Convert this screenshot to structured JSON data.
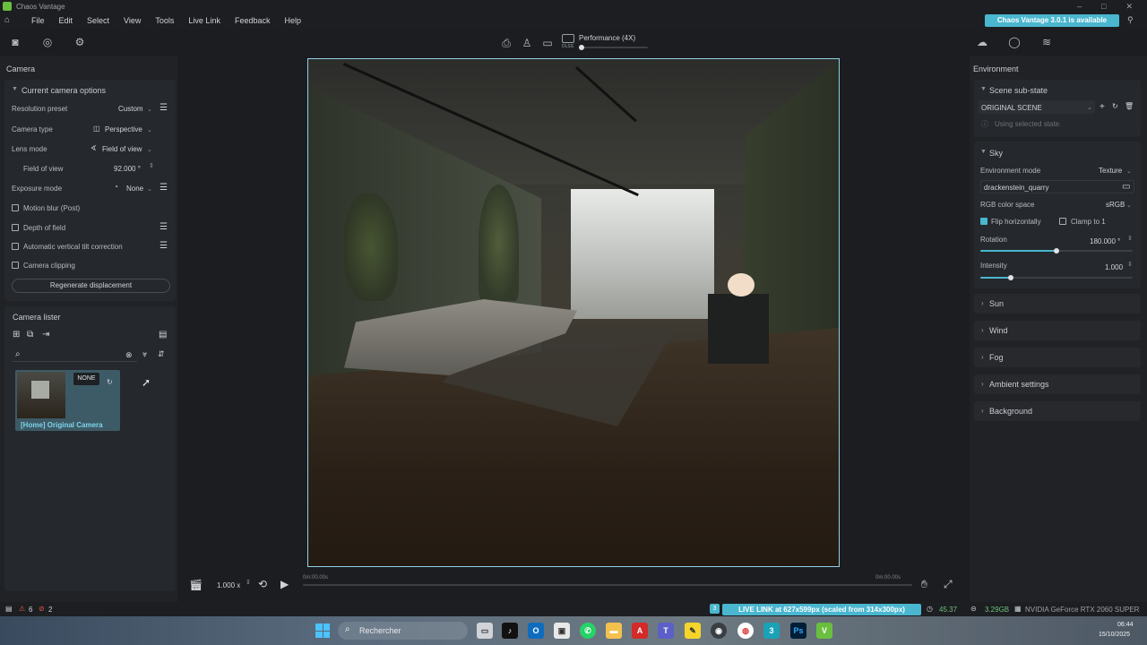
{
  "window": {
    "title": "Chaos Vantage",
    "controls": [
      "–",
      "□",
      "✕"
    ]
  },
  "menu": [
    "File",
    "Edit",
    "Select",
    "View",
    "Tools",
    "Live Link",
    "Feedback",
    "Help"
  ],
  "update_badge": "Chaos Vantage 3.0.1 is available",
  "top_toolbar": {
    "performance_label": "Performance (4X)",
    "dlss": "DLSS"
  },
  "left": {
    "panel_title": "Camera",
    "camera_options": {
      "header": "Current camera options",
      "resolution_preset": {
        "label": "Resolution preset",
        "value": "Custom"
      },
      "camera_type": {
        "label": "Camera type",
        "value": "Perspective"
      },
      "lens_mode": {
        "label": "Lens mode",
        "value": "Field of view"
      },
      "field_of_view": {
        "label": "Field of view",
        "value": "92.000 °"
      },
      "exposure_mode": {
        "label": "Exposure mode",
        "value": "None"
      },
      "motion_blur": "Motion blur (Post)",
      "depth_of_field": "Depth of field",
      "vertical_tilt": "Automatic vertical tilt correction",
      "camera_clipping": "Camera clipping",
      "regenerate": "Regenerate displacement"
    },
    "lister": {
      "title": "Camera lister",
      "search_placeholder": "",
      "item": {
        "badge": "NONE",
        "name": "[Home] Original Camera"
      }
    }
  },
  "timeline": {
    "speed": "1.000 x",
    "start_time": "0m:00.00s",
    "end_time": "0m:00.00s"
  },
  "right": {
    "panel_title": "Environment",
    "scene_sub_state": {
      "header": "Scene sub-state",
      "value": "ORIGINAL SCENE",
      "note": "Using selected state."
    },
    "sky": {
      "header": "Sky",
      "environment_mode": {
        "label": "Environment mode",
        "value": "Texture"
      },
      "texture_name": "drackenstein_quarry",
      "rgb_color_space": {
        "label": "RGB color space",
        "value": "sRGB"
      },
      "flip_horizontally": "Flip horizontally",
      "clamp": "Clamp to 1",
      "rotation": {
        "label": "Rotation",
        "value": "180.000 °",
        "fraction": 0.5
      },
      "intensity": {
        "label": "Intensity",
        "value": "1.000",
        "fraction": 0.2
      }
    },
    "sections": [
      "Sun",
      "Wind",
      "Fog",
      "Ambient settings",
      "Background"
    ]
  },
  "status": {
    "warnings": "6",
    "errors": "2",
    "live_link": "LIVE LINK at 627x599px (scaled from 314x300px)",
    "fps": "45.37",
    "memory": "3.29GB",
    "gpu": "NVIDIA GeForce RTX 2060 SUPER"
  },
  "taskbar": {
    "search": "Rechercher",
    "time": "06:44",
    "date": "15/10/2025"
  },
  "colors": {
    "accent": "#4ab6cf",
    "bg": "#1b1d20",
    "panel": "#202226"
  }
}
